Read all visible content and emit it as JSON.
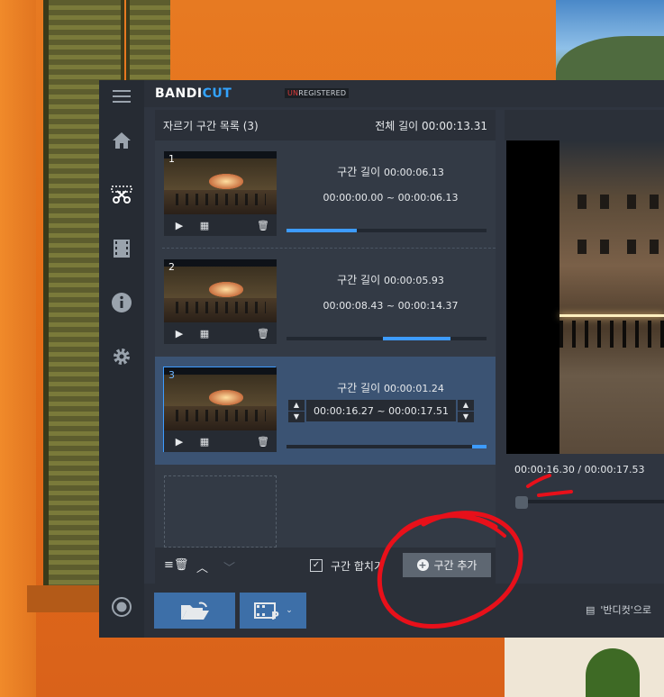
{
  "app": {
    "brand_main": "BANDI",
    "brand_accent": "CUT",
    "badge_prefix": "UN",
    "badge_rest": "REGISTERED"
  },
  "sidebar": {
    "items": [
      {
        "name": "menu-icon"
      },
      {
        "name": "home-icon"
      },
      {
        "name": "cut-icon"
      },
      {
        "name": "film-icon"
      },
      {
        "name": "info-icon"
      },
      {
        "name": "gear-icon"
      },
      {
        "name": "record-icon"
      }
    ]
  },
  "list": {
    "title": "자르기 구간 목록 (3)",
    "total_label": "전체 길이",
    "total_value": "00:00:13.31",
    "segments": [
      {
        "index": "1",
        "len_label": "구간 길이",
        "len_value": "00:00:06.13",
        "range": "00:00:00.00 ~ 00:00:06.13",
        "bar_start": 0.0,
        "bar_end": 0.35
      },
      {
        "index": "2",
        "len_label": "구간 길이",
        "len_value": "00:00:05.93",
        "range": "00:00:08.43 ~ 00:00:14.37",
        "bar_start": 0.48,
        "bar_end": 0.82
      },
      {
        "index": "3",
        "len_label": "구간 길이",
        "len_value": "00:00:01.24",
        "range": "00:00:16.27 ~ 00:00:17.51",
        "bar_start": 0.93,
        "bar_end": 1.0
      }
    ]
  },
  "footer": {
    "merge_label": "구간 합치기",
    "merge_checked": true,
    "add_label": "구간 추가"
  },
  "player": {
    "current": "00:00:16.30",
    "separator": "/",
    "duration": "00:00:17.53",
    "position": 0.93
  },
  "bottom": {
    "chat_text": "'반디컷'으로"
  },
  "colors": {
    "accent": "#3d9bff",
    "panel": "#333a45",
    "selected": "#3b5373",
    "annotation": "#e8101a"
  }
}
